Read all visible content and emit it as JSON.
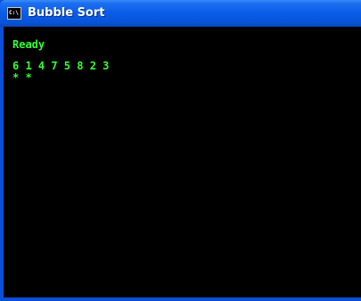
{
  "window": {
    "title": "Bubble Sort",
    "icon": "console-icon",
    "icon_text": "C:\\"
  },
  "console": {
    "text_color": "#33ff33",
    "background": "#000000",
    "status": "Ready",
    "numbers": "6 1 4 7 5 8 2 3",
    "markers": "* *"
  }
}
